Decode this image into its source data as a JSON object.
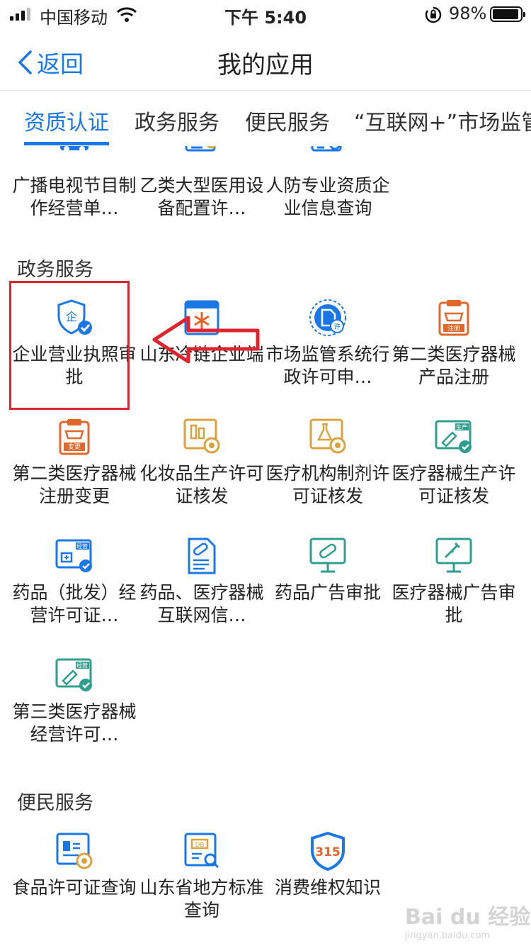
{
  "status": {
    "carrier": "中国移动",
    "time": "下午 5:40",
    "battery": "98%"
  },
  "nav": {
    "back": "返回",
    "title": "我的应用"
  },
  "tabs": [
    "资质认证",
    "政务服务",
    "便民服务",
    "“互联网+”市场监管"
  ],
  "top_items": [
    "广播电视节目制作经营单…",
    "乙类大型医用设备配置许…",
    "人防专业资质企业信息查询"
  ],
  "sections": {
    "gov": {
      "title": "政务服务",
      "items": [
        "企业营业执照审批",
        "山东冷链企业端",
        "市场监管系统行政许可申…",
        "第二类医疗器械产品注册",
        "第二类医疗器械注册变更",
        "化妆品生产许可证核发",
        "医疗机构制剂许可证核发",
        "医疗器械生产许可证核发",
        "药品（批发）经营许可证…",
        "药品、医疗器械互联网信…",
        "药品广告审批",
        "医疗器械广告审批",
        "第三类医疗器械经营许可…"
      ]
    },
    "civil": {
      "title": "便民服务",
      "items": [
        "食品许可证查询",
        "山东省地方标准查询",
        "消费维权知识"
      ]
    }
  },
  "icon_labels": {
    "qi": "企",
    "xu": "许",
    "zhuce": "注册",
    "biangeng": "变更",
    "shengchan": "生产",
    "jingying": "经营",
    "db": "DB",
    "n315": "315"
  },
  "watermark": {
    "brand": "Bai du 经验",
    "url": "jingyan.baidu.com"
  },
  "colors": {
    "accent": "#1a78e6",
    "highlight": "#e0242e",
    "orange": "#e2662a",
    "gold": "#d9a23c",
    "teal": "#2f9e8f"
  }
}
